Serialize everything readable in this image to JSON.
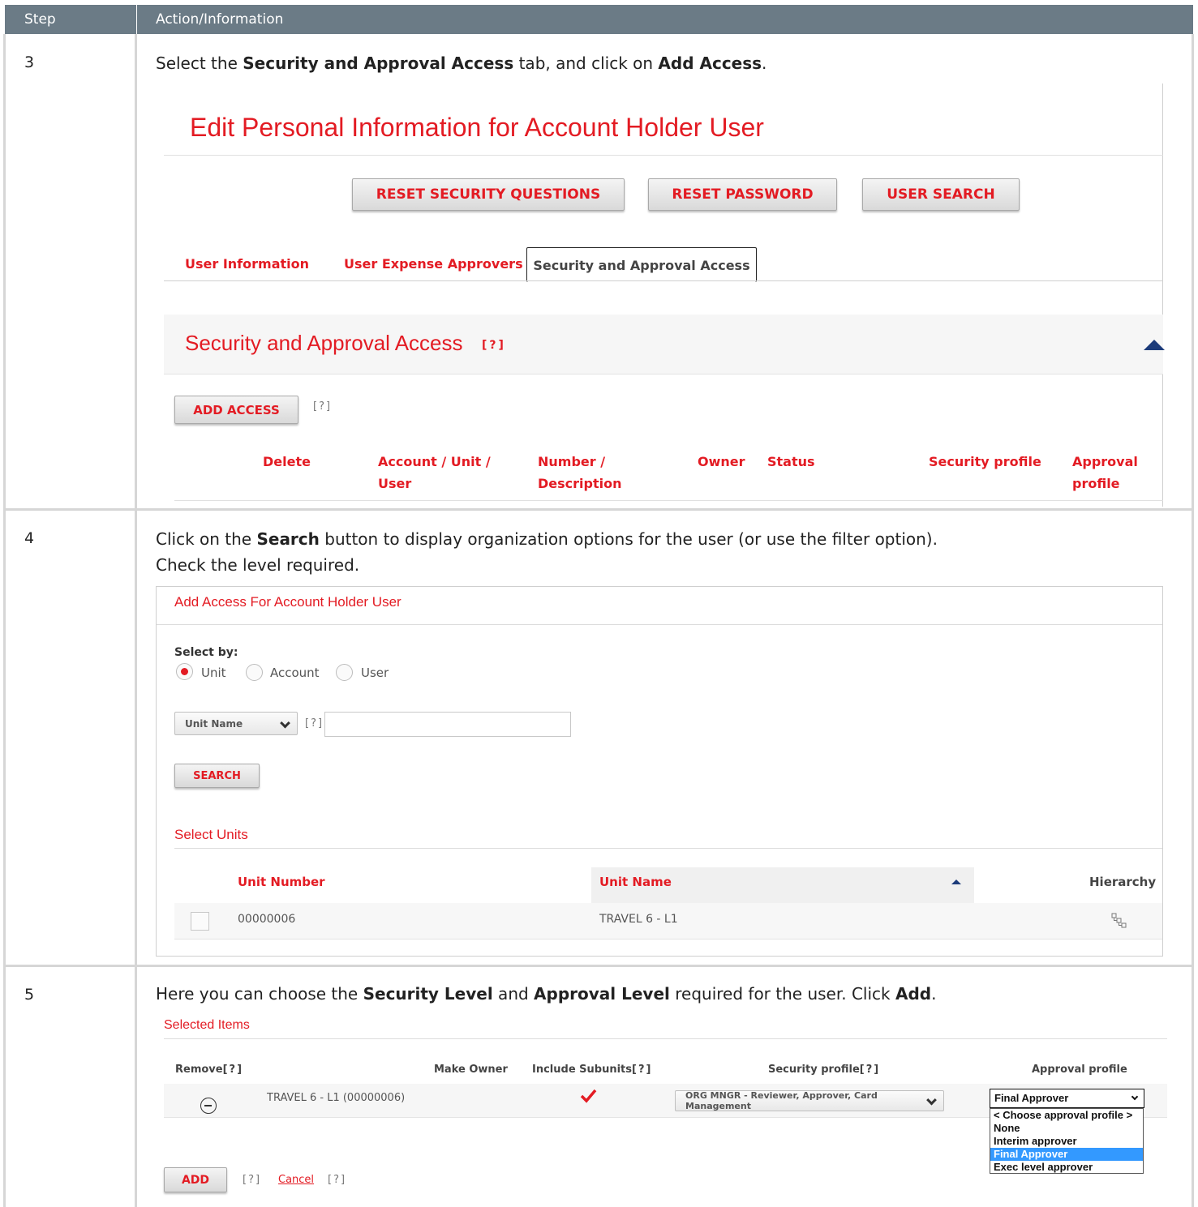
{
  "table": {
    "col_step": "Step",
    "col_action": "Action/Information"
  },
  "step3": {
    "num": "3",
    "instr_1": "Select the ",
    "instr_b1": "Security and Approval Access",
    "instr_2": " tab, and click on ",
    "instr_b2": "Add Access",
    "instr_3": ".",
    "screen": {
      "title": "Edit Personal Information for Account Holder User",
      "btn_reset_q": "RESET SECURITY QUESTIONS",
      "btn_reset_pw": "RESET PASSWORD",
      "btn_user_search": "USER SEARCH",
      "tab_user_info": "User Information",
      "tab_expense": "User Expense Approvers",
      "tab_security": "Security and Approval Access",
      "section_title": "Security and Approval Access",
      "help": "[?]",
      "btn_add_access": "ADD ACCESS",
      "columns": {
        "delete": "Delete",
        "account_1": "Account / Unit /",
        "account_2": "User",
        "number_1": "Number /",
        "number_2": "Description",
        "owner": "Owner",
        "status": "Status",
        "security": "Security profile",
        "approval_1": "Approval",
        "approval_2": "profile"
      }
    }
  },
  "step4": {
    "num": "4",
    "instr_1": "Click on the ",
    "instr_b1": "Search",
    "instr_2": " button to display organization options for the user (or use the filter option).",
    "instr_line2": "Check the level required.",
    "screen": {
      "title": "Add Access For Account Holder User",
      "select_by": "Select by:",
      "radio_unit": "Unit",
      "radio_account": "Account",
      "radio_user": "User",
      "filter_value": "Unit Name",
      "help": "[?]",
      "btn_search": "SEARCH",
      "select_units": "Select Units",
      "col_unit_number": "Unit Number",
      "col_unit_name": "Unit Name",
      "col_hierarchy": "Hierarchy",
      "rows": [
        {
          "unit_number": "00000006",
          "unit_name": "TRAVEL 6 - L1"
        }
      ]
    }
  },
  "step5": {
    "num": "5",
    "instr_1": "Here you can choose the ",
    "instr_b1": "Security Level",
    "instr_2": " and ",
    "instr_b2": "Approval Level",
    "instr_3": " required for the user. Click ",
    "instr_b3": "Add",
    "instr_4": ".",
    "screen": {
      "title": "Selected Items",
      "col_remove": "Remove",
      "col_make_owner": "Make Owner",
      "col_include": "Include Subunits",
      "col_security": "Security profile",
      "col_approval": "Approval profile",
      "help": "[?]",
      "item": "TRAVEL 6 - L1 (00000006)",
      "security_value": "ORG MNGR - Reviewer, Approver, Card Management",
      "approval_value": "Final Approver",
      "approval_options": [
        "< Choose approval profile >",
        "None",
        "Interim approver",
        "Final Approver",
        "Exec level approver"
      ],
      "btn_add": "ADD",
      "cancel": "Cancel"
    }
  }
}
